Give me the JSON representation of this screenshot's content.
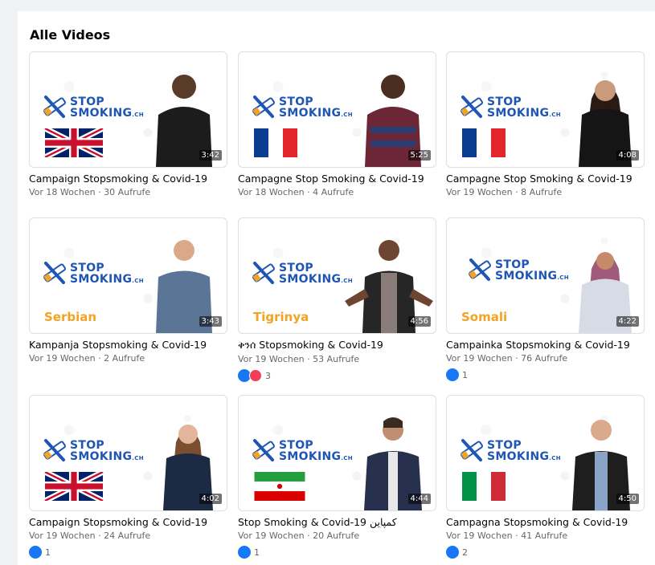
{
  "section_title": "Alle Videos",
  "logo": {
    "line1": "STOP",
    "line2": "SMOKING",
    "suffix": ".CH"
  },
  "colors": {
    "brand_blue": "#1f56b5",
    "label_orange": "#f2a324",
    "like_blue": "#1877f2",
    "love_red": "#f33e58"
  },
  "videos": [
    {
      "title": "Campaign Stopsmoking & Covid-19",
      "age": "Vor 18 Wochen",
      "views": "30 Aufrufe",
      "duration": "3:42",
      "flag": "uk",
      "label": "",
      "reactions": [],
      "reaction_count": ""
    },
    {
      "title": "Campagne Stop Smoking & Covid-19",
      "age": "Vor 18 Wochen",
      "views": "4 Aufrufe",
      "duration": "5:25",
      "flag": "france",
      "label": "",
      "reactions": [],
      "reaction_count": ""
    },
    {
      "title": "Campagne Stop Smoking & Covid-19",
      "age": "Vor 19 Wochen",
      "views": "8 Aufrufe",
      "duration": "4:08",
      "flag": "france",
      "label": "",
      "reactions": [],
      "reaction_count": ""
    },
    {
      "title": "Kampanja Stopsmoking & Covid-19",
      "age": "Vor 19 Wochen",
      "views": "2 Aufrufe",
      "duration": "3:43",
      "flag": "",
      "label": "Serbian",
      "reactions": [],
      "reaction_count": ""
    },
    {
      "title": "ቅንሰ Stopsmoking & Covid-19",
      "age": "Vor 19 Wochen",
      "views": "53 Aufrufe",
      "duration": "4:56",
      "flag": "",
      "label": "Tigrinya",
      "reactions": [
        "like-icon",
        "love-icon"
      ],
      "reaction_count": "3"
    },
    {
      "title": "Campainka Stopsmoking & Covid-19",
      "age": "Vor 19 Wochen",
      "views": "76 Aufrufe",
      "duration": "4:22",
      "flag": "",
      "label": "Somali",
      "reactions": [
        "like-icon"
      ],
      "reaction_count": "1"
    },
    {
      "title": "Campaign Stopsmoking & Covid-19",
      "age": "Vor 19 Wochen",
      "views": "24 Aufrufe",
      "duration": "4:02",
      "flag": "uk",
      "label": "",
      "reactions": [
        "like-icon"
      ],
      "reaction_count": "1"
    },
    {
      "title": "Stop Smoking & Covid-19 کمپاین",
      "age": "Vor 19 Wochen",
      "views": "20 Aufrufe",
      "duration": "4:44",
      "flag": "iran",
      "label": "",
      "reactions": [
        "like-icon"
      ],
      "reaction_count": "1"
    },
    {
      "title": "Campagna Stopsmoking & Covid-19",
      "age": "Vor 19 Wochen",
      "views": "41 Aufrufe",
      "duration": "4:50",
      "flag": "italy",
      "label": "",
      "reactions": [
        "like-icon"
      ],
      "reaction_count": "2"
    }
  ]
}
